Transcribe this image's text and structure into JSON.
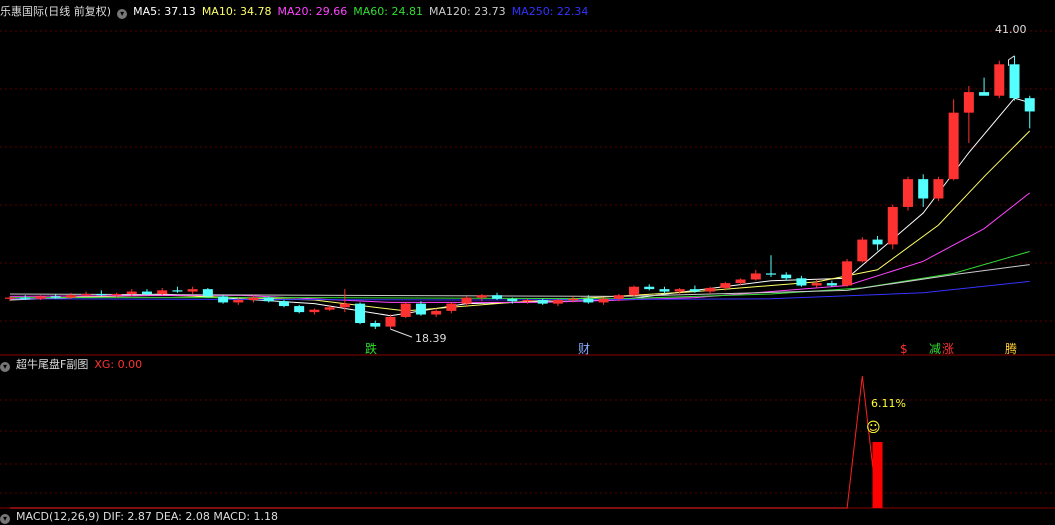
{
  "main_header": {
    "title": "乐惠国际(日线 前复权)",
    "ma": [
      {
        "label": "MA5: 37.13",
        "color": "#ffffff"
      },
      {
        "label": "MA10: 34.78",
        "color": "#ffff66"
      },
      {
        "label": "MA20: 29.66",
        "color": "#ff44ff"
      },
      {
        "label": "MA60: 24.81",
        "color": "#33dd33"
      },
      {
        "label": "MA120: 23.73",
        "color": "#cccccc"
      },
      {
        "label": "MA250: 22.34",
        "color": "#3333ff"
      }
    ]
  },
  "sub_header": {
    "title": "超牛尾盘F副图",
    "xg": "XG: 0.00"
  },
  "bottom_header": {
    "text": "MACD(12,26,9)  DIF: 2.87  DEA: 2.08  MACD: 1.18"
  },
  "annotations": {
    "high_label": "41.00",
    "low_label": "18.39",
    "marker_die": "跌",
    "marker_cai": "财",
    "marker_s": "$",
    "marker_jian": "减",
    "marker_zhang": "涨",
    "marker_teng": "腾",
    "percent_label": "6.11%",
    "smiley": "☺"
  },
  "colors": {
    "up": "#ff3232",
    "down": "#54ffff",
    "grid": "#5a0000",
    "xg_line": "#ff2020",
    "xg_bar": "#ff0000"
  },
  "chart_data": {
    "type": "candlestick",
    "ylim": [
      16.5,
      43.8
    ],
    "candles": [
      [
        20.9,
        21.1,
        20.7,
        21.0
      ],
      [
        21.0,
        21.2,
        20.8,
        20.9
      ],
      [
        20.9,
        21.2,
        20.8,
        21.1
      ],
      [
        21.1,
        21.3,
        20.9,
        21.0
      ],
      [
        21.0,
        21.4,
        20.9,
        21.2
      ],
      [
        21.2,
        21.5,
        21.1,
        21.3
      ],
      [
        21.3,
        21.6,
        21.1,
        21.2
      ],
      [
        21.2,
        21.4,
        21.0,
        21.3
      ],
      [
        21.3,
        21.7,
        21.1,
        21.5
      ],
      [
        21.5,
        21.7,
        21.2,
        21.3
      ],
      [
        21.3,
        21.8,
        21.2,
        21.6
      ],
      [
        21.6,
        21.9,
        21.4,
        21.5
      ],
      [
        21.5,
        21.9,
        21.3,
        21.7
      ],
      [
        21.7,
        21.8,
        21.0,
        21.1
      ],
      [
        21.1,
        21.2,
        20.5,
        20.6
      ],
      [
        20.6,
        21.0,
        20.4,
        20.8
      ],
      [
        20.8,
        21.2,
        20.6,
        21.0
      ],
      [
        21.0,
        21.1,
        20.6,
        20.7
      ],
      [
        20.7,
        20.8,
        20.2,
        20.3
      ],
      [
        20.3,
        20.4,
        19.7,
        19.8
      ],
      [
        19.8,
        20.1,
        19.6,
        20.0
      ],
      [
        20.0,
        20.4,
        19.9,
        20.2
      ],
      [
        20.2,
        21.7,
        19.8,
        20.5
      ],
      [
        20.5,
        20.6,
        18.8,
        18.9
      ],
      [
        18.9,
        19.1,
        18.4,
        18.6
      ],
      [
        18.6,
        19.6,
        18.39,
        19.4
      ],
      [
        19.4,
        20.6,
        19.3,
        20.5
      ],
      [
        20.5,
        20.7,
        19.5,
        19.6
      ],
      [
        19.6,
        20.1,
        19.4,
        19.9
      ],
      [
        19.9,
        20.6,
        19.7,
        20.5
      ],
      [
        20.5,
        21.1,
        20.3,
        21.0
      ],
      [
        21.0,
        21.3,
        20.7,
        21.2
      ],
      [
        21.2,
        21.4,
        20.8,
        20.9
      ],
      [
        20.9,
        21.0,
        20.5,
        20.7
      ],
      [
        20.7,
        20.9,
        20.5,
        20.8
      ],
      [
        20.8,
        20.9,
        20.4,
        20.5
      ],
      [
        20.5,
        20.9,
        20.3,
        20.8
      ],
      [
        20.8,
        21.1,
        20.6,
        20.9
      ],
      [
        20.9,
        21.2,
        20.5,
        20.6
      ],
      [
        20.6,
        21.0,
        20.4,
        20.9
      ],
      [
        20.9,
        21.3,
        20.7,
        21.2
      ],
      [
        21.2,
        22.0,
        21.1,
        21.9
      ],
      [
        21.9,
        22.1,
        21.6,
        21.7
      ],
      [
        21.7,
        21.9,
        21.3,
        21.5
      ],
      [
        21.5,
        21.8,
        21.3,
        21.7
      ],
      [
        21.7,
        22.0,
        21.4,
        21.5
      ],
      [
        21.5,
        21.9,
        21.3,
        21.8
      ],
      [
        21.8,
        22.3,
        21.6,
        22.2
      ],
      [
        22.2,
        22.6,
        22.0,
        22.5
      ],
      [
        22.5,
        23.3,
        22.4,
        23.0
      ],
      [
        23.0,
        24.5,
        22.7,
        22.9
      ],
      [
        22.9,
        23.1,
        22.4,
        22.6
      ],
      [
        22.6,
        22.8,
        21.9,
        22.0
      ],
      [
        22.0,
        22.5,
        21.8,
        22.2
      ],
      [
        22.2,
        22.4,
        21.9,
        22.0
      ],
      [
        22.0,
        24.2,
        21.9,
        24.0
      ],
      [
        24.0,
        26.0,
        23.9,
        25.8
      ],
      [
        25.8,
        26.1,
        24.9,
        25.4
      ],
      [
        25.4,
        28.7,
        25.0,
        28.5
      ],
      [
        28.5,
        31.0,
        28.2,
        30.8
      ],
      [
        30.8,
        31.2,
        28.5,
        29.2
      ],
      [
        29.2,
        31.0,
        29.0,
        30.8
      ],
      [
        30.8,
        37.4,
        30.7,
        36.3
      ],
      [
        36.3,
        38.5,
        33.8,
        38.0
      ],
      [
        38.0,
        39.2,
        37.8,
        37.7
      ],
      [
        37.7,
        40.6,
        37.5,
        40.3
      ],
      [
        40.3,
        41.0,
        37.3,
        37.5
      ],
      [
        37.5,
        37.7,
        35.0,
        36.4
      ]
    ],
    "ma": [
      {
        "name": "MA5",
        "color": "#ffffff",
        "values": [
          [
            0,
            20.8
          ],
          [
            10,
            21.3
          ],
          [
            20,
            20.5
          ],
          [
            25,
            19.5
          ],
          [
            30,
            20.5
          ],
          [
            40,
            20.8
          ],
          [
            50,
            22.4
          ],
          [
            55,
            22.6
          ],
          [
            60,
            28.0
          ],
          [
            63,
            33.0
          ],
          [
            66,
            37.5
          ],
          [
            67,
            37.13
          ]
        ]
      },
      {
        "name": "MA10",
        "color": "#ffff66",
        "values": [
          [
            0,
            20.9
          ],
          [
            10,
            21.2
          ],
          [
            20,
            20.8
          ],
          [
            26,
            19.9
          ],
          [
            33,
            20.6
          ],
          [
            45,
            21.5
          ],
          [
            53,
            22.3
          ],
          [
            57,
            23.3
          ],
          [
            61,
            27.0
          ],
          [
            64,
            31.0
          ],
          [
            67,
            34.78
          ]
        ]
      },
      {
        "name": "MA20",
        "color": "#ff44ff",
        "values": [
          [
            0,
            21.1
          ],
          [
            15,
            21.2
          ],
          [
            25,
            20.6
          ],
          [
            35,
            20.6
          ],
          [
            45,
            21.0
          ],
          [
            55,
            22.0
          ],
          [
            60,
            24.0
          ],
          [
            64,
            26.7
          ],
          [
            67,
            29.66
          ]
        ]
      },
      {
        "name": "MA60",
        "color": "#33dd33",
        "values": [
          [
            0,
            21.0
          ],
          [
            20,
            21.0
          ],
          [
            40,
            20.9
          ],
          [
            50,
            21.3
          ],
          [
            56,
            21.8
          ],
          [
            62,
            23.0
          ],
          [
            67,
            24.81
          ]
        ]
      },
      {
        "name": "MA120",
        "color": "#cccccc",
        "values": [
          [
            0,
            21.3
          ],
          [
            20,
            21.2
          ],
          [
            40,
            21.1
          ],
          [
            55,
            21.6
          ],
          [
            62,
            22.9
          ],
          [
            67,
            23.73
          ]
        ]
      },
      {
        "name": "MA250",
        "color": "#3333ff",
        "values": [
          [
            0,
            20.9
          ],
          [
            30,
            20.8
          ],
          [
            50,
            20.9
          ],
          [
            60,
            21.4
          ],
          [
            67,
            22.34
          ]
        ]
      }
    ],
    "xg_line": [
      [
        0,
        0
      ],
      [
        55,
        0
      ],
      [
        56,
        1
      ],
      [
        57,
        0
      ]
    ],
    "xg_bar_index": 57
  }
}
